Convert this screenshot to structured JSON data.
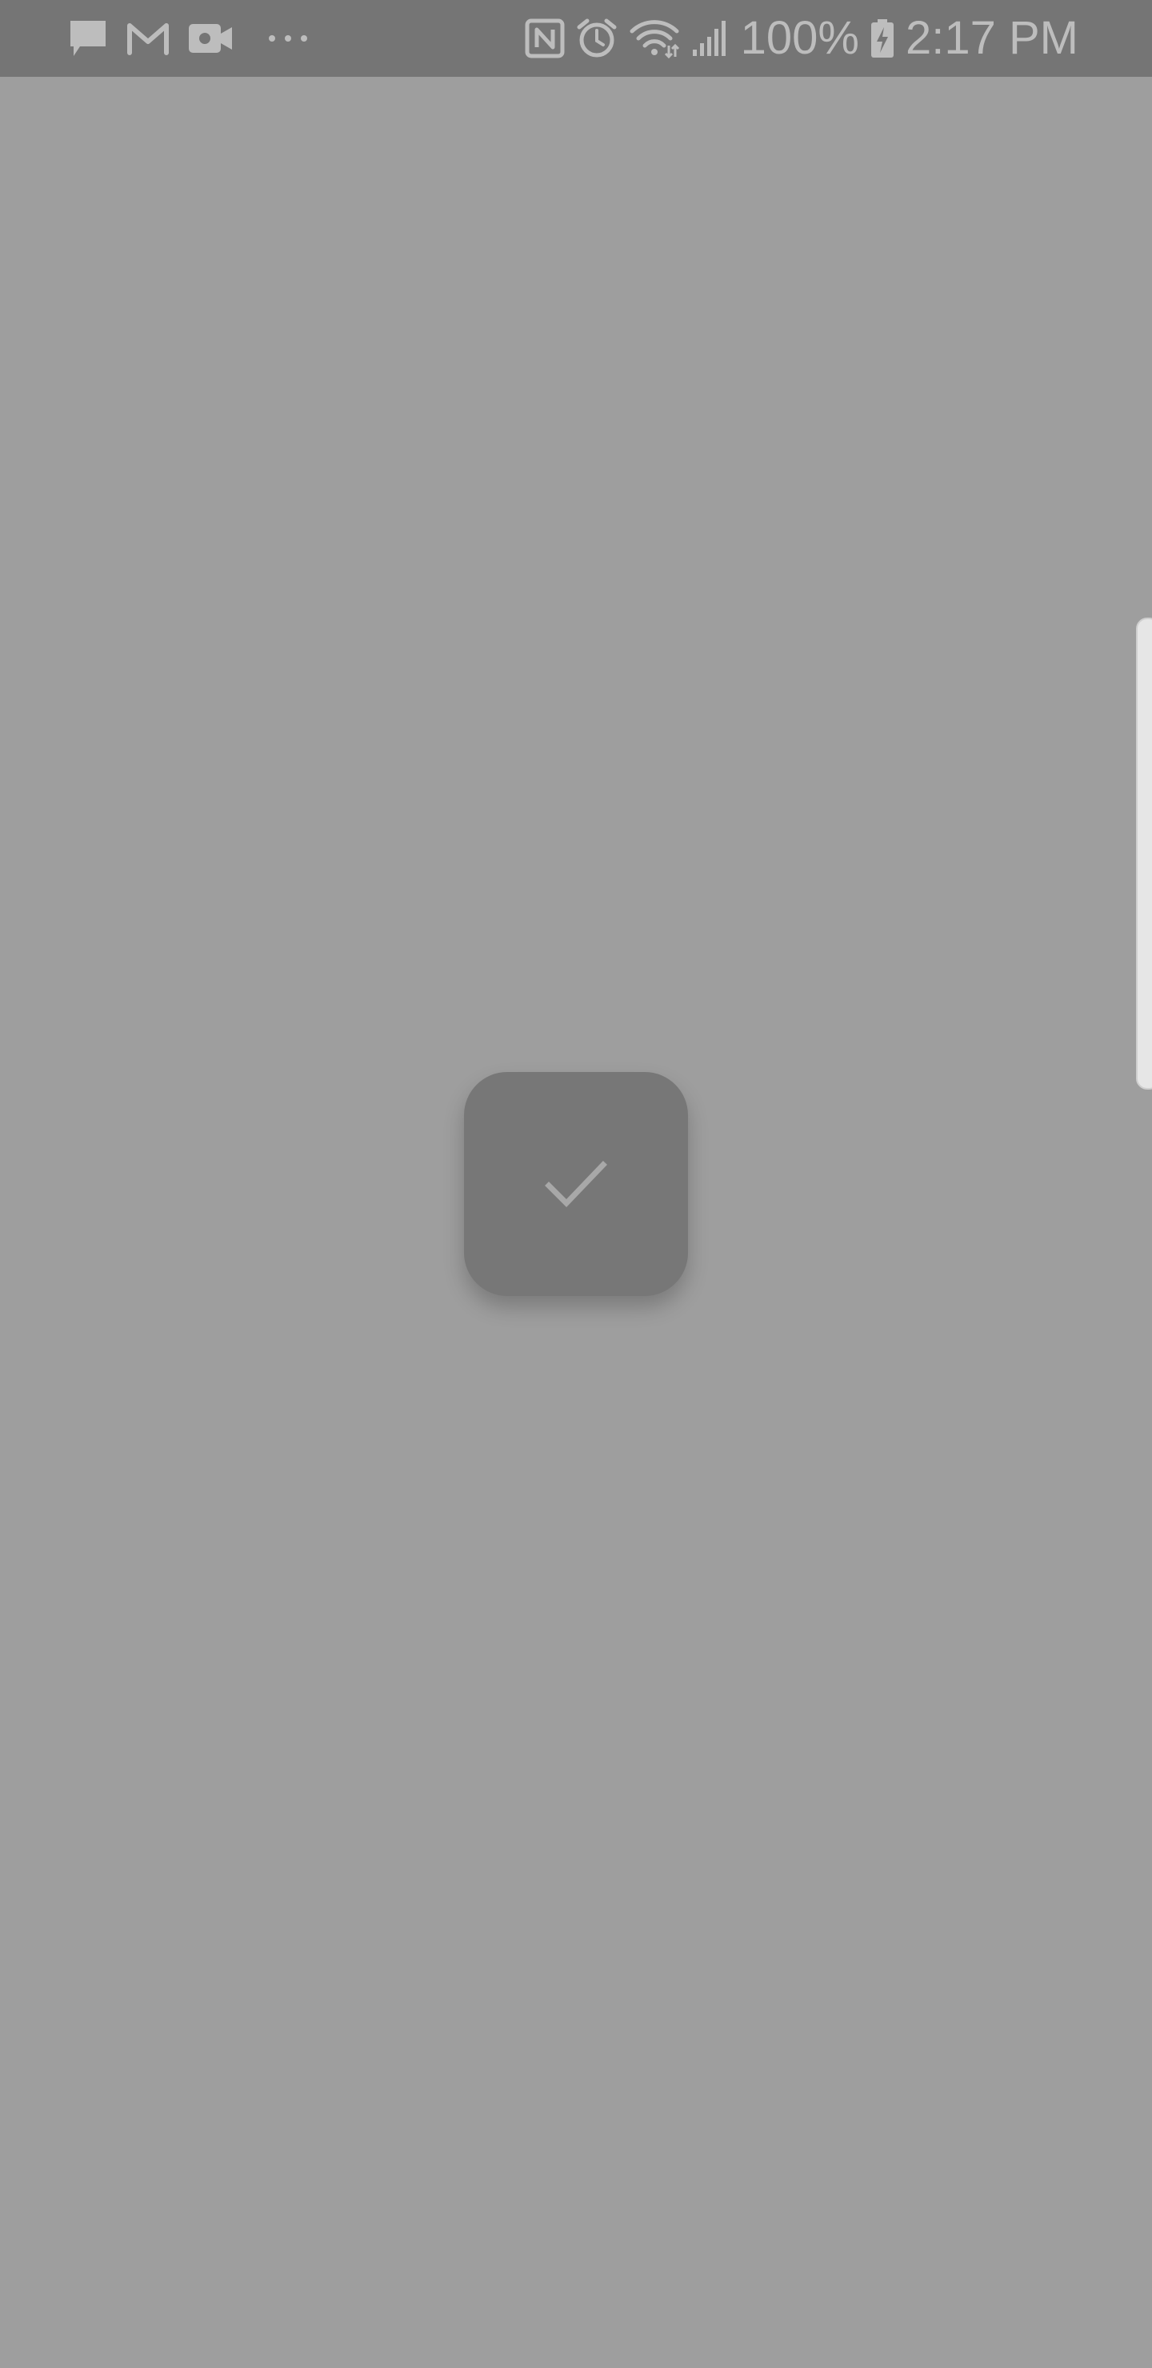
{
  "status_bar": {
    "left_icons": [
      "message-icon",
      "gmail-icon",
      "video-camera-icon",
      "more-dots-icon"
    ],
    "right_icons": [
      "nfc-icon",
      "alarm-icon",
      "wifi-icon",
      "signal-icon",
      "battery-charging-icon"
    ],
    "battery_text": "100%",
    "time": "2:17 PM"
  },
  "main": {
    "check_button": {
      "icon": "check-icon"
    }
  },
  "colors": {
    "background": "#9e9e9e",
    "status_bar": "#757575",
    "button": "#777777",
    "icon": "#bdbdbd",
    "edge_handle": "#e6e6e6"
  }
}
